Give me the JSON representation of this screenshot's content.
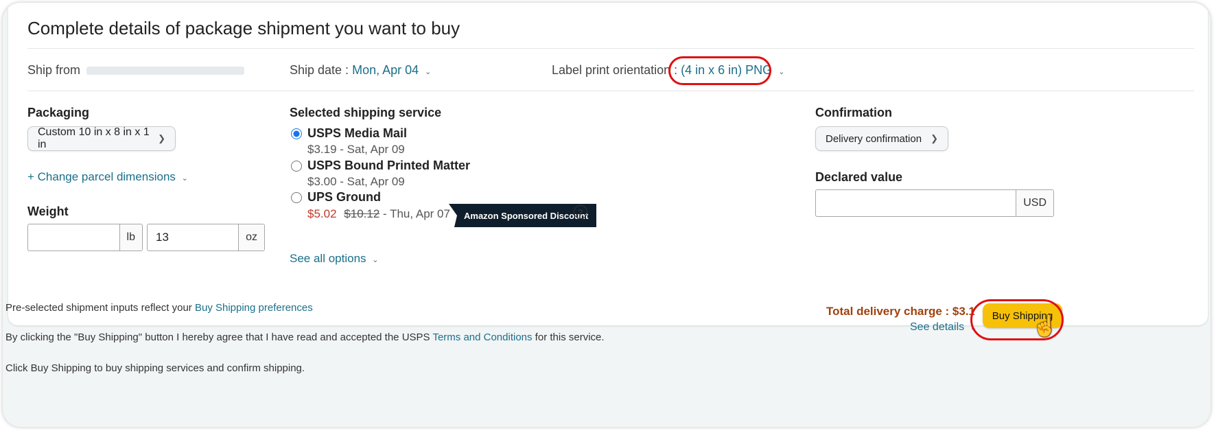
{
  "page": {
    "title": "Complete details of package shipment you want to buy"
  },
  "header_row": {
    "ship_from_label": "Ship from",
    "ship_date_label": "Ship date :",
    "ship_date_value": "Mon, Apr 04",
    "label_orientation_label": "Label print orientation :",
    "label_orientation_value": "(4 in x 6 in) PNG"
  },
  "packaging": {
    "heading": "Packaging",
    "selected": "Custom 10 in x 8 in x 1 in",
    "change_link": "+ Change parcel dimensions"
  },
  "weight": {
    "heading": "Weight",
    "lb_value": "",
    "lb_unit": "lb",
    "oz_value": "13",
    "oz_unit": "oz"
  },
  "shipping_service": {
    "heading": "Selected shipping service",
    "options": [
      {
        "name": "USPS Media Mail",
        "price": "$3.19",
        "detail": " - Sat, Apr 09",
        "selected": true
      },
      {
        "name": "USPS Bound Printed Matter",
        "price": "$3.00",
        "detail": " - Sat, Apr 09",
        "selected": false
      },
      {
        "name": "UPS Ground",
        "price": "$5.02",
        "old_price": "$10.12",
        "detail": " - Thu, Apr 07",
        "badge": "Amazon Sponsored Discount",
        "help": "?",
        "selected": false
      }
    ],
    "see_all": "See all options"
  },
  "confirmation": {
    "heading": "Confirmation",
    "selected": "Delivery confirmation"
  },
  "declared_value": {
    "heading": "Declared value",
    "value": "",
    "unit": "USD"
  },
  "footer": {
    "pre_selected_text": "Pre-selected shipment inputs reflect your ",
    "pre_selected_link": "Buy Shipping preferences",
    "agree_text_1": "By clicking the \"Buy Shipping\" button I hereby agree that I have read and accepted the USPS ",
    "agree_link": "Terms and Conditions",
    "agree_text_2": " for this service.",
    "click_text": "Click Buy Shipping to buy shipping services and confirm shipping.",
    "total_label": "Total delivery charge : $3.19",
    "see_details": "See details",
    "buy_button": "Buy Shipping"
  },
  "colors": {
    "link": "#1a6f8a",
    "annotation": "#e01010",
    "buy_button": "#f7c10a",
    "total": "#a0410d"
  }
}
